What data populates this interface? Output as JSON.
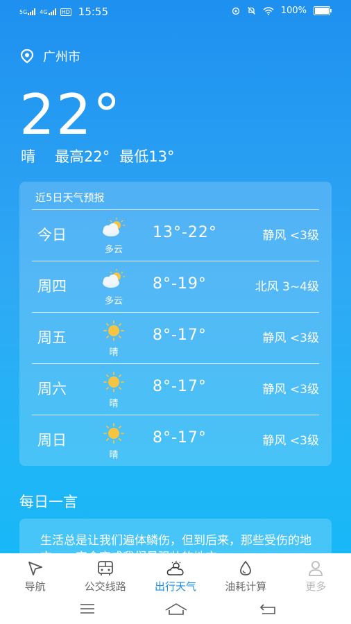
{
  "status_bar": {
    "sig1": "5G",
    "sig2": "4G",
    "hd": "HD",
    "time": "15:55",
    "battery": "100%"
  },
  "location": {
    "city": "广州市"
  },
  "current": {
    "temp": "22°",
    "condition": "晴",
    "high": "最高22°",
    "low": "最低13°"
  },
  "forecast": {
    "title": "近5日天气预报",
    "days": [
      {
        "day": "今日",
        "icon": "partly-cloudy-icon",
        "cond": "多云",
        "temp": "13°-22°",
        "wind": "静风  <3级"
      },
      {
        "day": "周四",
        "icon": "partly-cloudy-icon",
        "cond": "多云",
        "temp": "8°-19°",
        "wind": "北风  3~4级"
      },
      {
        "day": "周五",
        "icon": "sun-icon",
        "cond": "晴",
        "temp": "8°-17°",
        "wind": "静风  <3级"
      },
      {
        "day": "周六",
        "icon": "sun-icon",
        "cond": "晴",
        "temp": "8°-17°",
        "wind": "静风  <3级"
      },
      {
        "day": "周日",
        "icon": "sun-icon",
        "cond": "晴",
        "temp": "8°-17°",
        "wind": "静风  <3级"
      }
    ]
  },
  "quote": {
    "title": "每日一言",
    "text": "生活总是让我们遍体鳞伤，但到后来，那些受伤的地方，一定会变成我们最强壮的地方。"
  },
  "nav": {
    "items": [
      {
        "label": "导航",
        "icon": "navigation-arrow-icon"
      },
      {
        "label": "公交线路",
        "icon": "bus-icon"
      },
      {
        "label": "出行天气",
        "icon": "weather-cloud-icon"
      },
      {
        "label": "油耗计算",
        "icon": "fuel-drop-icon"
      },
      {
        "label": "更多",
        "icon": "user-icon"
      }
    ],
    "active_index": 2,
    "accent": "#1a8fe8"
  }
}
